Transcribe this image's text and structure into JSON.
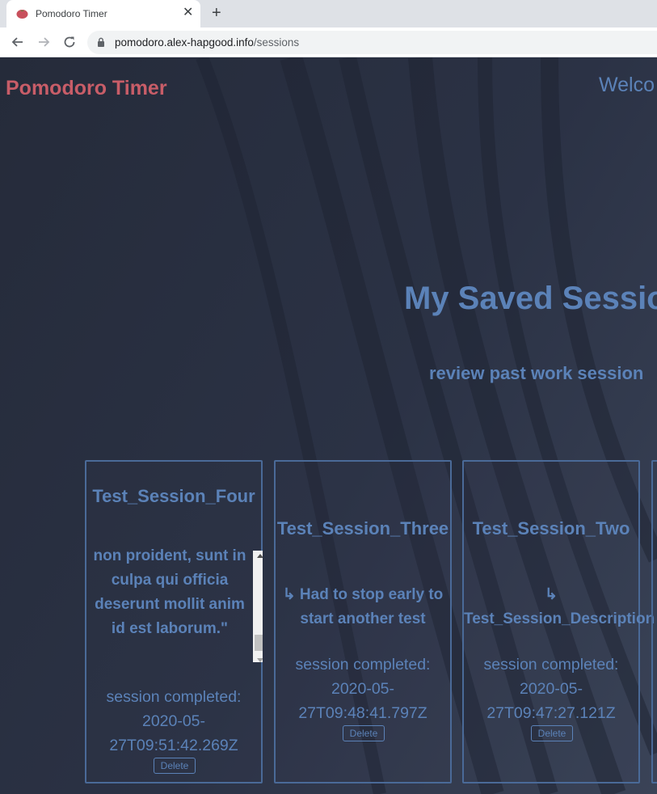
{
  "browser": {
    "tab_title": "Pomodoro Timer",
    "close_glyph": "✕",
    "new_tab_glyph": "+",
    "url_host": "pomodoro.alex-hapgood.info",
    "url_path": "/sessions"
  },
  "header": {
    "brand": "Pomodoro Timer",
    "welcome": "Welco"
  },
  "main": {
    "title": "My Saved Sessio",
    "subtitle": "review past work session"
  },
  "sessions": [
    {
      "name": "Test_Session_Four",
      "description": "non proident, sunt in culpa qui officia deserunt mollit anim id est laborum.\"",
      "completed_label": "session completed:",
      "date_line1": "2020-05-",
      "date_line2": "27T09:51:42.269Z",
      "delete_label": "Delete"
    },
    {
      "name": "Test_Session_Three",
      "description_line1": "↳ Had to stop early to",
      "description_line2": "start another test",
      "completed_label": "session completed:",
      "date_line1": "2020-05-",
      "date_line2": "27T09:48:41.797Z",
      "delete_label": "Delete"
    },
    {
      "name": "Test_Session_Two",
      "description_line1": "↳",
      "description_line2": "Test_Session_Description",
      "completed_label": "session completed:",
      "date_line1": "2020-05-",
      "date_line2": "27T09:47:27.121Z",
      "delete_label": "Delete"
    }
  ],
  "colors": {
    "brand": "#c85d68",
    "accent": "#5b82b8",
    "background": "#2a3142"
  }
}
